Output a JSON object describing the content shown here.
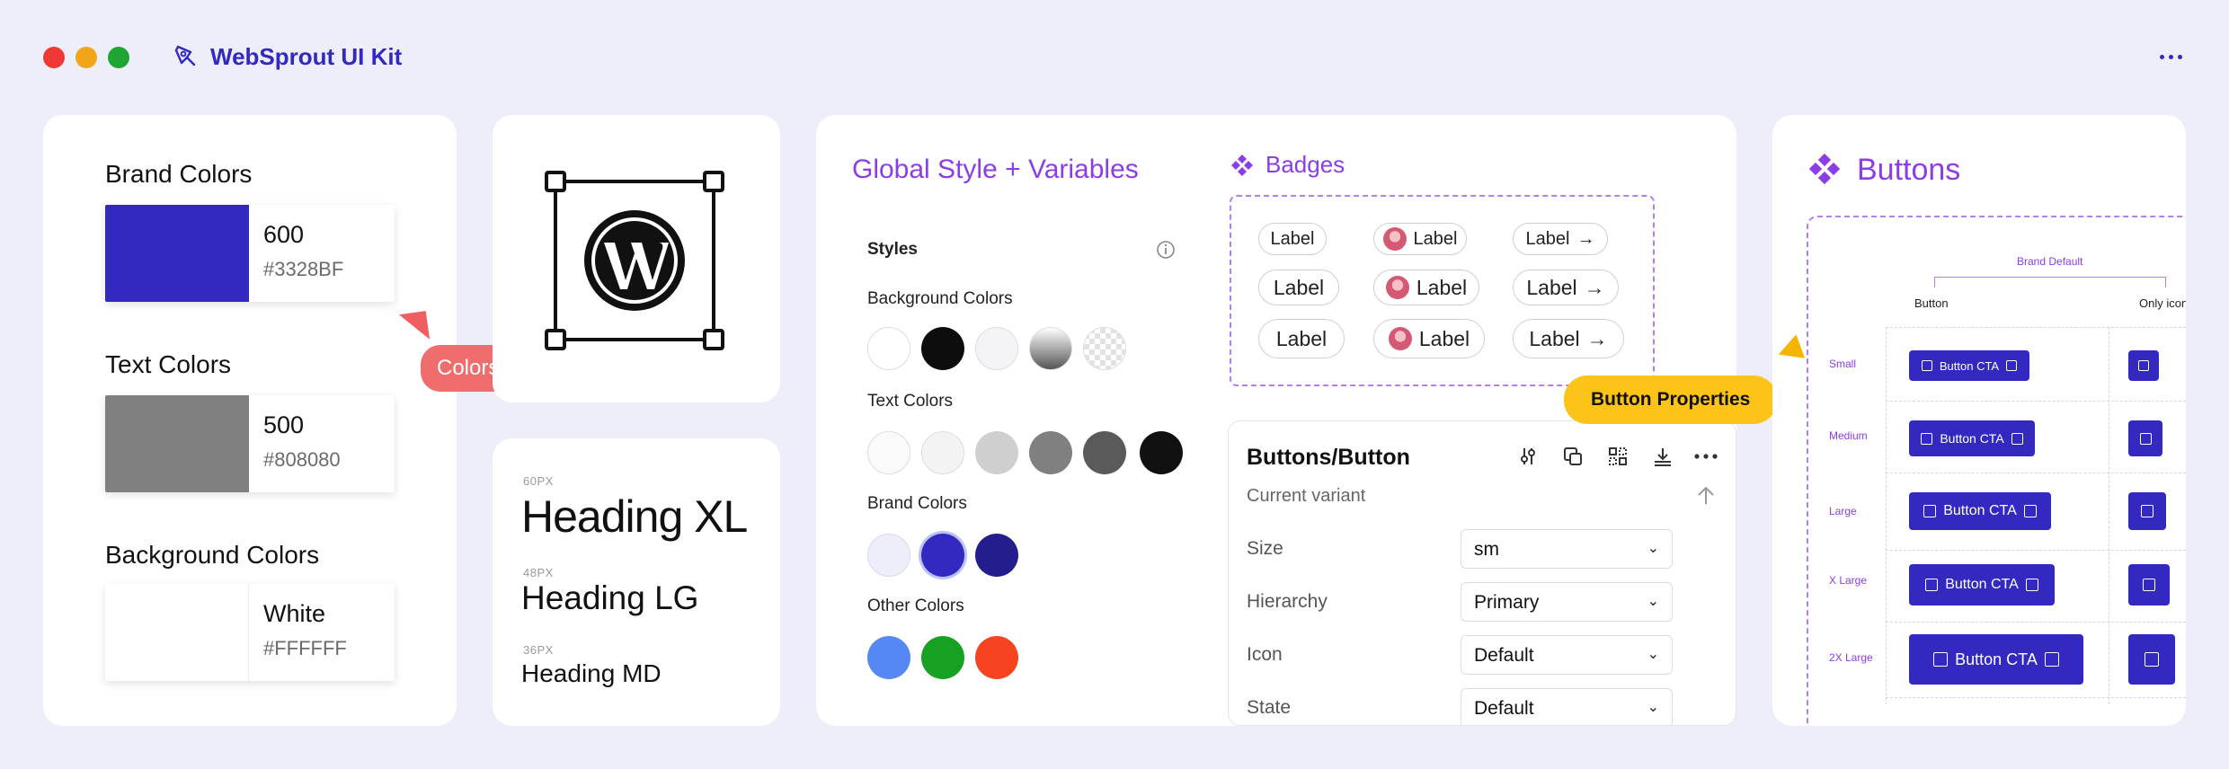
{
  "app": {
    "title": "WebSprout UI Kit"
  },
  "colors_card": {
    "brand": {
      "title": "Brand Colors",
      "shade": "600",
      "hex": "#3328BF",
      "color": "#3328BF"
    },
    "text": {
      "title": "Text Colors",
      "shade": "500",
      "hex": "#808080",
      "color": "#808080"
    },
    "background": {
      "title": "Background Colors",
      "shade": "White",
      "hex": "#FFFFFF",
      "color": "#FFFFFF"
    },
    "tag": "Colors"
  },
  "headings": [
    {
      "caption": "60PX",
      "label": "Heading XL"
    },
    {
      "caption": "48PX",
      "label": "Heading LG"
    },
    {
      "caption": "36PX",
      "label": "Heading MD"
    }
  ],
  "global": {
    "title": "Global Style + Variables",
    "styles_label": "Styles",
    "bg_label": "Background Colors",
    "text_label": "Text Colors",
    "brand_label": "Brand Colors",
    "other_label": "Other Colors"
  },
  "badges": {
    "title": "Badges",
    "label": "Label"
  },
  "tag_button_properties": "Button Properties",
  "props": {
    "title": "Buttons/Button",
    "subtitle": "Current variant",
    "rows": [
      {
        "label": "Size",
        "value": "sm"
      },
      {
        "label": "Hierarchy",
        "value": "Primary"
      },
      {
        "label": "Icon",
        "value": "Default"
      },
      {
        "label": "State",
        "value": "Default"
      }
    ]
  },
  "buttons": {
    "title": "Buttons",
    "group": "Brand Default",
    "col_button": "Button",
    "col_icon": "Only icon",
    "cta": "Button CTA",
    "sizes": [
      "Small",
      "Medium",
      "Large",
      "X Large",
      "2X Large"
    ]
  }
}
